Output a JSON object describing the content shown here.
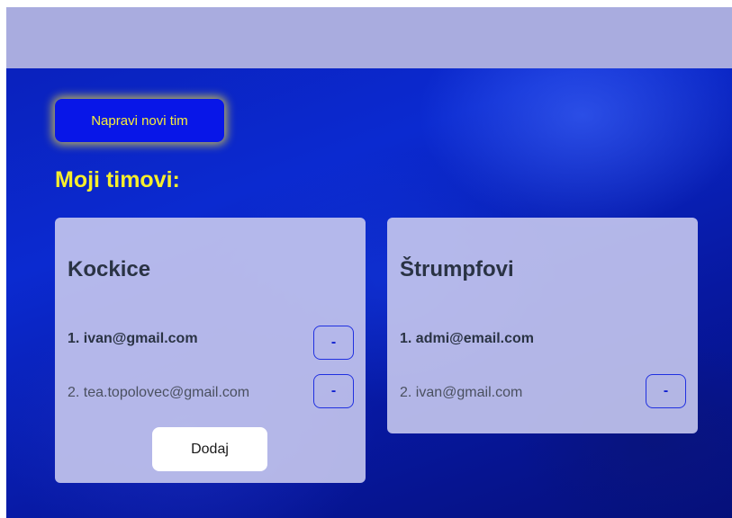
{
  "header": {
    "new_team_label": "Napravi novi tim"
  },
  "section": {
    "title": "Moji timovi:"
  },
  "teams": [
    {
      "name": "Kockice",
      "members": [
        {
          "label": "1. ivan@gmail.com",
          "remove_label": "-"
        },
        {
          "label": "2. tea.topolovec@gmail.com",
          "remove_label": "-"
        }
      ],
      "add_label": "Dodaj"
    },
    {
      "name": "Štrumpfovi",
      "members": [
        {
          "label": "1. admi@email.com"
        },
        {
          "label": "2. ivan@gmail.com",
          "remove_label": "-"
        }
      ]
    }
  ],
  "colors": {
    "accent_yellow": "#f7ee2c",
    "button_blue": "#0816e8",
    "topbar": "#a9acdf",
    "card": "#c6c8ee"
  }
}
